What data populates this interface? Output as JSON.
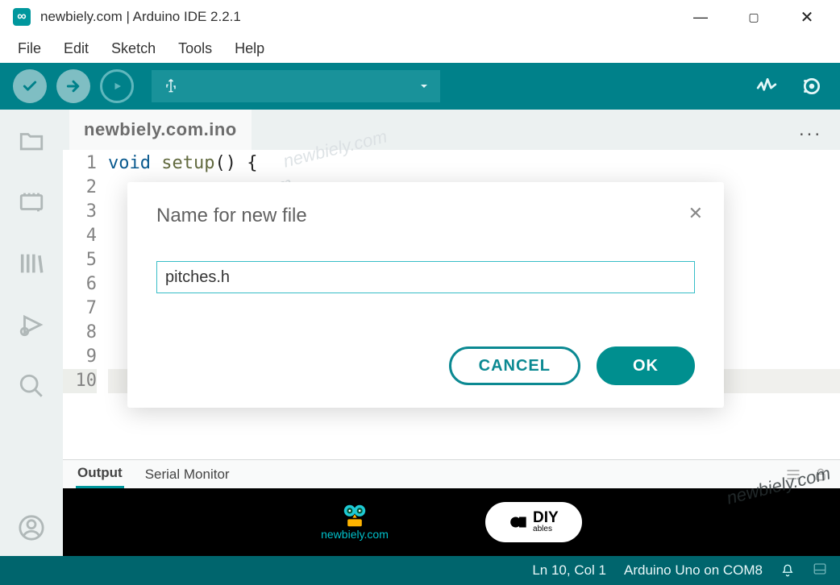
{
  "titlebar": {
    "title": "newbiely.com | Arduino IDE 2.2.1"
  },
  "menubar": {
    "items": [
      "File",
      "Edit",
      "Sketch",
      "Tools",
      "Help"
    ]
  },
  "toolbar": {
    "board_icon": "usb",
    "dropdown": ""
  },
  "sidebar": {
    "items": [
      "folder",
      "board",
      "library",
      "debug",
      "search",
      "account"
    ]
  },
  "tab": {
    "name": "newbiely.com.ino"
  },
  "tab_more": "...",
  "code": {
    "lines": [
      "1",
      "2",
      "3",
      "4",
      "5",
      "6",
      "7",
      "8",
      "9",
      "10"
    ],
    "line1_kw": "void",
    "line1_fn": "setup",
    "line1_rest": "() {"
  },
  "bottom_tabs": {
    "output": "Output",
    "serial": "Serial Monitor"
  },
  "brand": {
    "newbiely": "newbiely.com",
    "diy": "DIY",
    "diy_sub": "ables"
  },
  "status": {
    "pos": "Ln 10, Col 1",
    "board": "Arduino Uno on COM8"
  },
  "modal": {
    "title": "Name for new file",
    "value": "pitches.h",
    "cancel": "CANCEL",
    "ok": "OK"
  },
  "watermark": "newbiely.com"
}
